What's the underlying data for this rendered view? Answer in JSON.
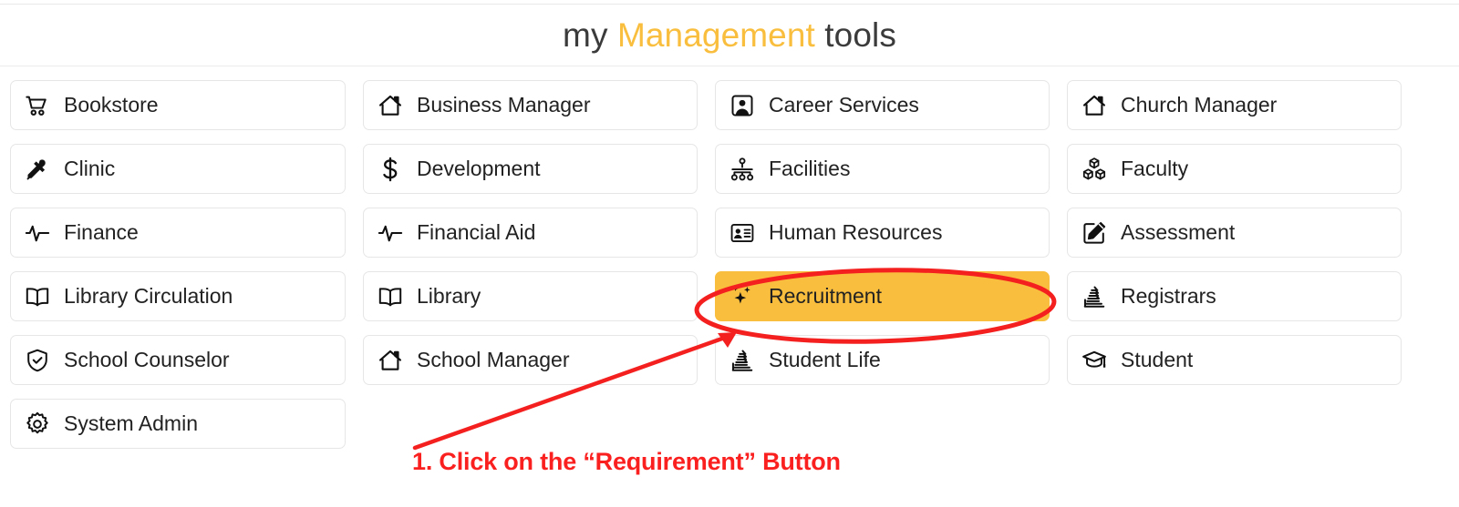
{
  "header": {
    "title_prefix": "my ",
    "title_accent": "Management",
    "title_suffix": " tools",
    "accent_color": "#f9be3d"
  },
  "annotation": {
    "text": "1. Click on the “Requirement” Button",
    "color": "#fb2020",
    "highlight_target": "Recruitment",
    "highlight_color": "#f9be3d",
    "shapes": [
      "ellipse-highlight",
      "arrow"
    ]
  },
  "grid": {
    "columns": [
      {
        "name": "column-1",
        "items": [
          {
            "label": "Bookstore",
            "icon": "shopping-cart-icon"
          },
          {
            "label": "Clinic",
            "icon": "eyedropper-icon"
          },
          {
            "label": "Finance",
            "icon": "pulse-activity-icon"
          },
          {
            "label": "Library Circulation",
            "icon": "open-book-icon"
          },
          {
            "label": "School Counselor",
            "icon": "shield-check-icon"
          },
          {
            "label": "System Admin",
            "icon": "gear-icon"
          }
        ]
      },
      {
        "name": "column-2",
        "items": [
          {
            "label": "Business Manager",
            "icon": "house-icon"
          },
          {
            "label": "Development",
            "icon": "dollar-sign-icon"
          },
          {
            "label": "Financial Aid",
            "icon": "pulse-activity-icon"
          },
          {
            "label": "Library",
            "icon": "open-book-icon"
          },
          {
            "label": "School Manager",
            "icon": "house-icon"
          }
        ]
      },
      {
        "name": "column-3",
        "items": [
          {
            "label": "Career Services",
            "icon": "portrait-person-icon"
          },
          {
            "label": "Facilities",
            "icon": "org-chart-icon"
          },
          {
            "label": "Human Resources",
            "icon": "id-card-icon"
          },
          {
            "label": "Recruitment",
            "icon": "sparkles-icon",
            "highlighted": true
          },
          {
            "label": "Student Life",
            "icon": "fanned-pages-icon"
          }
        ]
      },
      {
        "name": "column-4",
        "items": [
          {
            "label": "Church Manager",
            "icon": "house-icon"
          },
          {
            "label": "Faculty",
            "icon": "cubes-icon"
          },
          {
            "label": "Assessment",
            "icon": "pencil-square-icon"
          },
          {
            "label": "Registrars",
            "icon": "fanned-pages-icon"
          },
          {
            "label": "Student",
            "icon": "graduation-cap-icon"
          }
        ]
      }
    ]
  }
}
